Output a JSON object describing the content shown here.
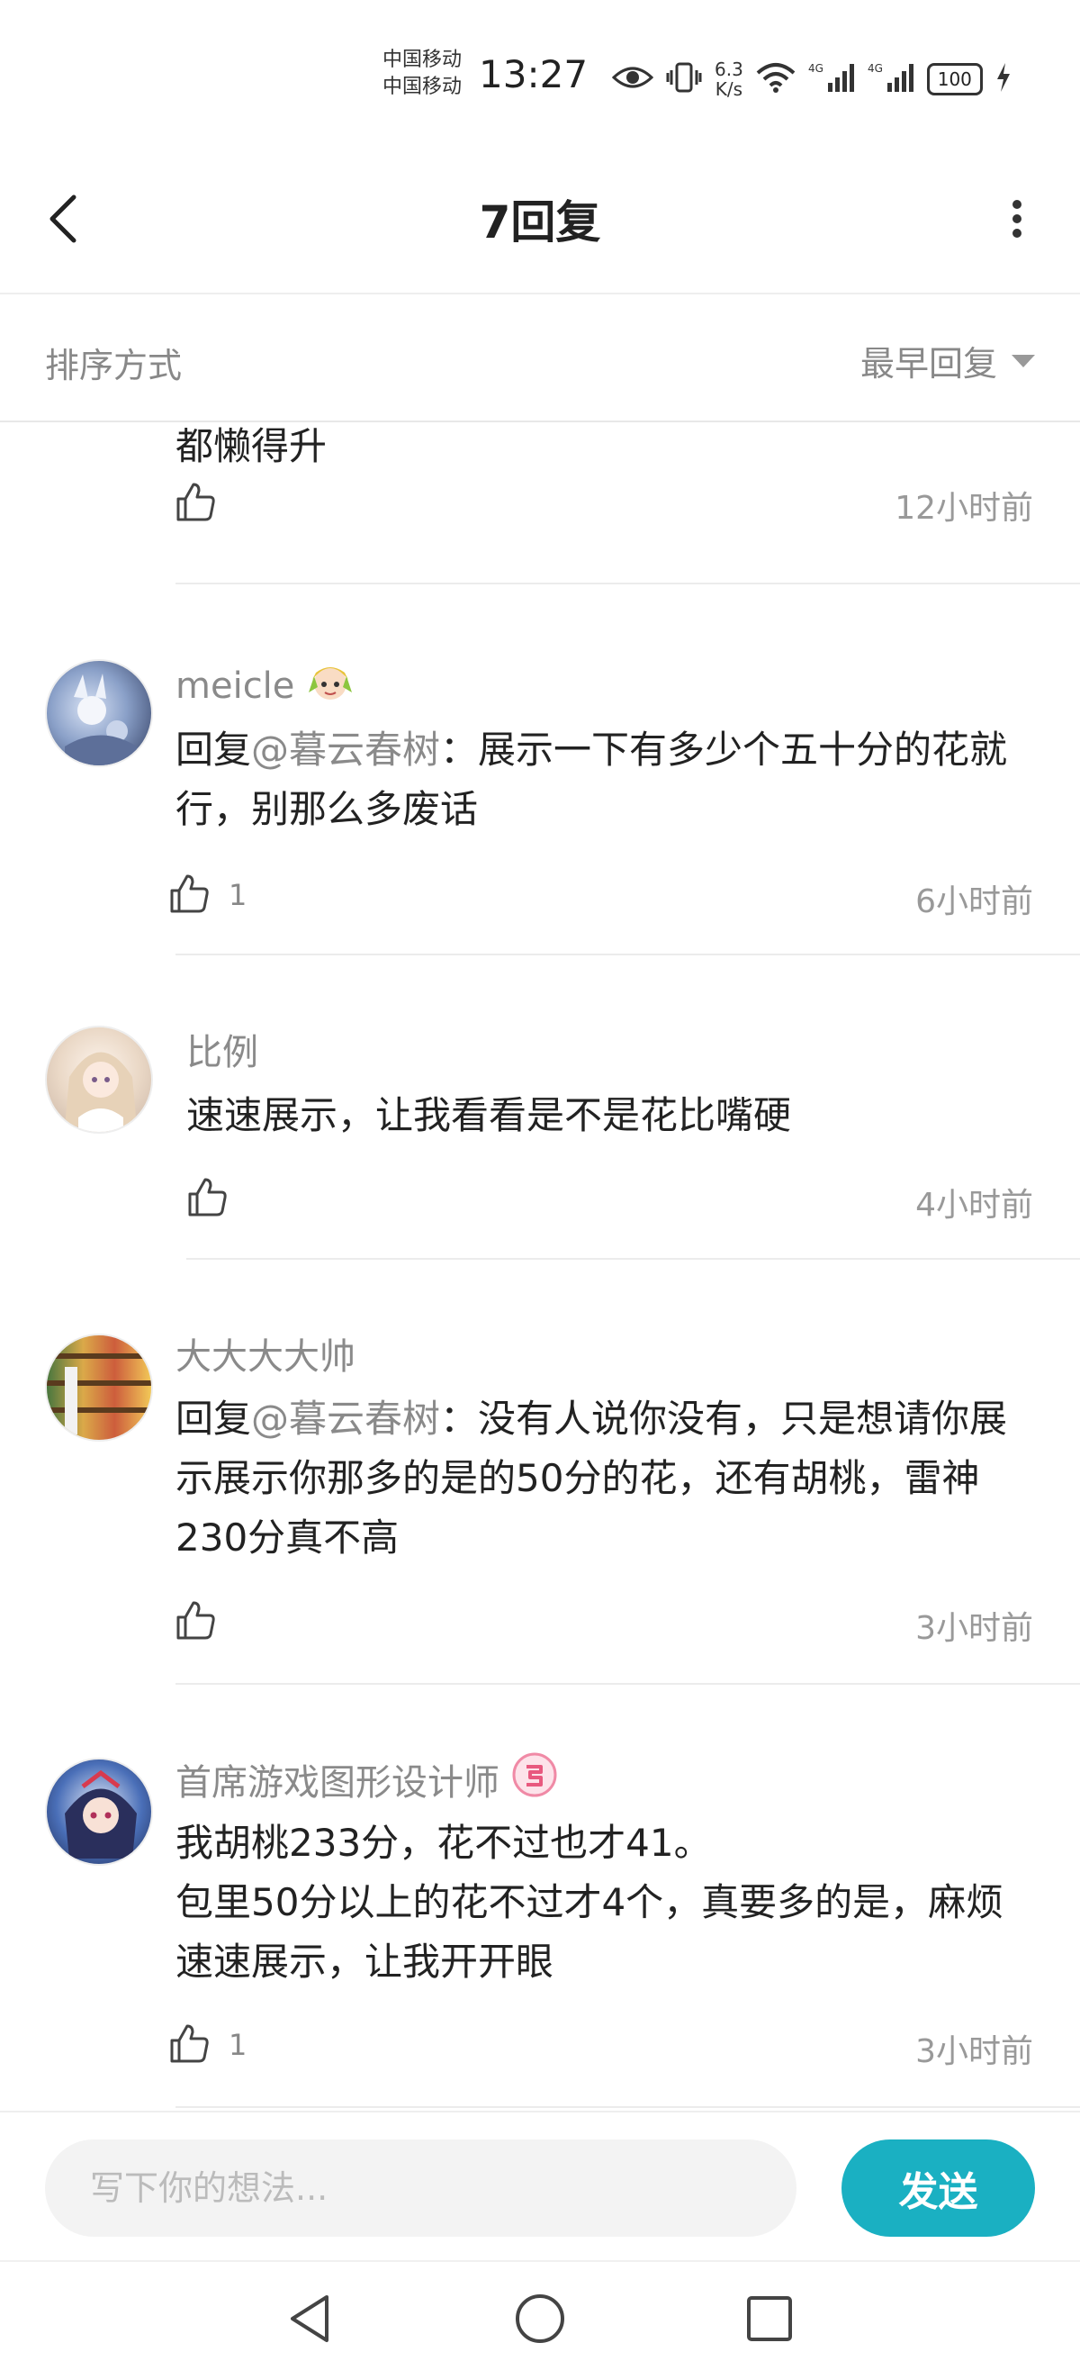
{
  "status_bar": {
    "carrier_1": "中国移动",
    "carrier_2": "中国移动",
    "time": "13:27",
    "speed_value": "6.3",
    "speed_unit": "K/s",
    "battery": "100",
    "icons": [
      "eye-icon",
      "vibrate-icon",
      "wifi-icon",
      "signal-4g-icon",
      "signal-4g-icon",
      "charging-icon"
    ]
  },
  "header": {
    "title": "7回复",
    "back_icon": "chevron-left-icon",
    "more_icon": "vertical-dots-icon"
  },
  "sort": {
    "label": "排序方式",
    "selected": "最早回复"
  },
  "replies": [
    {
      "partial": true,
      "text": "都懒得升",
      "likes": "",
      "time": "12小时前"
    },
    {
      "username": "meicle",
      "badge": "anime-character-badge",
      "reply_prefix": "回复",
      "mention": "@暮云春树",
      "text": "：展示一下有多少个五十分的花就行，别那么多废话",
      "likes": "1",
      "time": "6小时前"
    },
    {
      "username": "比例",
      "text": "速速展示，让我看看是不是花比嘴硬",
      "likes": "",
      "time": "4小时前"
    },
    {
      "username": "大大大大帅",
      "reply_prefix": "回复",
      "mention": "@暮云春树",
      "text": "：没有人说你没有，只是想请你展示展示你那多的是的50分的花，还有胡桃，雷神230分真不高",
      "likes": "",
      "time": "3小时前"
    },
    {
      "username": "首席游戏图形设计师",
      "badge": "pink-level-badge",
      "text_line1": "我胡桃233分，花不过也才41。",
      "text_line2": "包里50分以上的花不过才4个，真要多的是，麻烦速速展示，让我开开眼",
      "likes": "1",
      "time": "3小时前"
    }
  ],
  "composer": {
    "placeholder": "写下你的想法...",
    "send_label": "发送"
  },
  "colors": {
    "accent": "#1ab0c2",
    "text_primary": "#222222",
    "text_secondary": "#8a8a8a",
    "time_text": "#999999"
  }
}
